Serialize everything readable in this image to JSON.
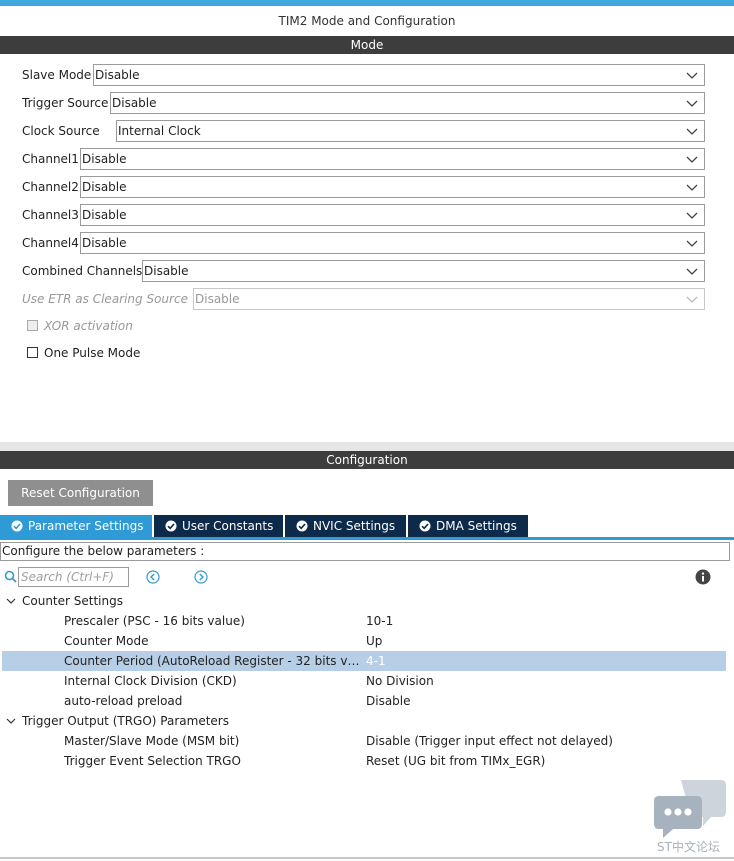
{
  "window": {
    "title": "TIM2 Mode and Configuration"
  },
  "mode": {
    "header": "Mode",
    "fields": [
      {
        "label": "Slave Mode",
        "value": "Disable"
      },
      {
        "label": "Trigger Source",
        "value": "Disable"
      },
      {
        "label": "Clock Source",
        "value": "Internal Clock"
      },
      {
        "label": "Channel1",
        "value": "Disable"
      },
      {
        "label": "Channel2",
        "value": "Disable"
      },
      {
        "label": "Channel3",
        "value": "Disable"
      },
      {
        "label": "Channel4",
        "value": "Disable"
      },
      {
        "label": "Combined Channels",
        "value": "Disable"
      },
      {
        "label": "Use ETR as Clearing Source",
        "value": "Disable",
        "disabled": true
      }
    ],
    "checkboxes": [
      {
        "label": "XOR activation",
        "checked": false,
        "disabled": true
      },
      {
        "label": "One Pulse Mode",
        "checked": false,
        "disabled": false
      }
    ]
  },
  "configuration": {
    "header": "Configuration",
    "reset_label": "Reset Configuration",
    "tabs": [
      {
        "label": "Parameter Settings",
        "active": true
      },
      {
        "label": "User Constants",
        "active": false
      },
      {
        "label": "NVIC Settings",
        "active": false
      },
      {
        "label": "DMA Settings",
        "active": false
      }
    ],
    "instructions": "Configure the below parameters :",
    "search_placeholder": "Search (Ctrl+F)",
    "groups": [
      {
        "label": "Counter Settings",
        "params": [
          {
            "name": "Prescaler (PSC - 16 bits value)",
            "value": "10-1"
          },
          {
            "name": "Counter Mode",
            "value": "Up"
          },
          {
            "name": "Counter Period (AutoReload Register - 32 bits val...",
            "value": "4-1",
            "selected": true
          },
          {
            "name": "Internal Clock Division (CKD)",
            "value": "No Division"
          },
          {
            "name": "auto-reload preload",
            "value": "Disable"
          }
        ]
      },
      {
        "label": "Trigger Output (TRGO) Parameters",
        "params": [
          {
            "name": "Master/Slave Mode (MSM bit)",
            "value": "Disable (Trigger input effect not delayed)"
          },
          {
            "name": "Trigger Event Selection TRGO",
            "value": "Reset (UG bit from TIMx_EGR)"
          }
        ]
      }
    ]
  },
  "watermark": {
    "text": "ST中文论坛"
  },
  "colors": {
    "accent": "#2e9bd6",
    "tab_inactive": "#0d2a4b",
    "section_bar": "#3d3d3d",
    "selected_row": "#b7cfe6",
    "reset_button": "#8f8f8f"
  }
}
